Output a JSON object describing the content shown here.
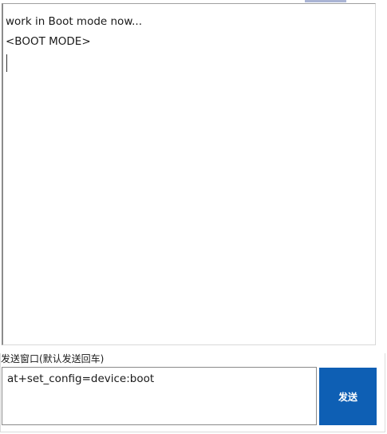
{
  "receive": {
    "lines": [
      "work in Boot mode now...",
      "<BOOT MODE>"
    ]
  },
  "send": {
    "caption": "发送窗口(默认发送回车)",
    "input_value": "at+set_config=device:boot",
    "button_label": "发送"
  },
  "colors": {
    "send_button": "#0e5fb4",
    "text": "#1a1a1a",
    "top_accent": "#aab4d4"
  }
}
